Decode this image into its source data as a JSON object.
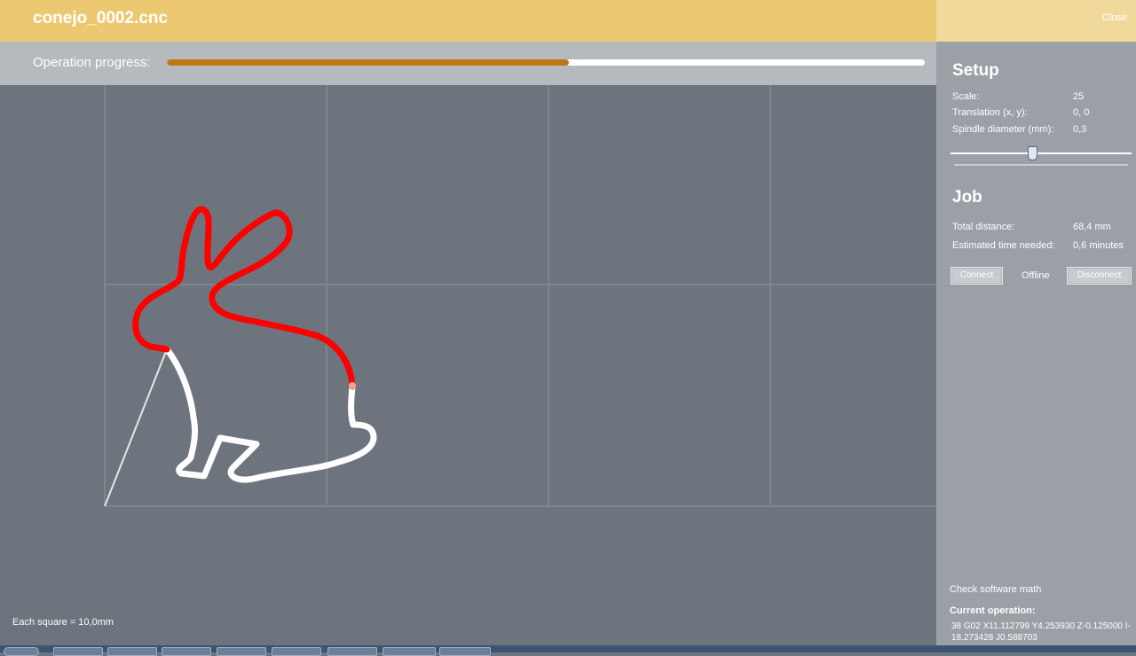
{
  "window": {
    "title": "conejo_0002.cnc",
    "close_label": "Close"
  },
  "progress": {
    "label": "Operation progress:",
    "fraction": 0.53,
    "track_color": "#ffffff",
    "fill_color": "#c1770f"
  },
  "canvas": {
    "scale_note": "Each square = 10,0mm",
    "cut_color": "#ff0000",
    "pending_color": "#ffffff"
  },
  "setup": {
    "heading": "Setup",
    "scale_label": "Scale:",
    "scale_value": "25",
    "translation_label": "Translation (x, y):",
    "translation_value": "0, 0",
    "spindle_label": "Spindle diameter (mm):",
    "spindle_value": "0,3",
    "slider_fraction": 0.45
  },
  "job": {
    "heading": "Job",
    "distance_label": "Total distance:",
    "distance_value": "68,4 mm",
    "time_label": "Estimated time needed:",
    "time_value": "0,6 minutes",
    "connect_label": "Connect",
    "status": "Offline",
    "disconnect_label": "Disconnect"
  },
  "footer": {
    "check_math": "Check software math",
    "current_heading": "Current operation:",
    "current_op": "38 G02 X11.112799 Y4.253930 Z-0.125000 I-18.273428 J0.588703"
  }
}
